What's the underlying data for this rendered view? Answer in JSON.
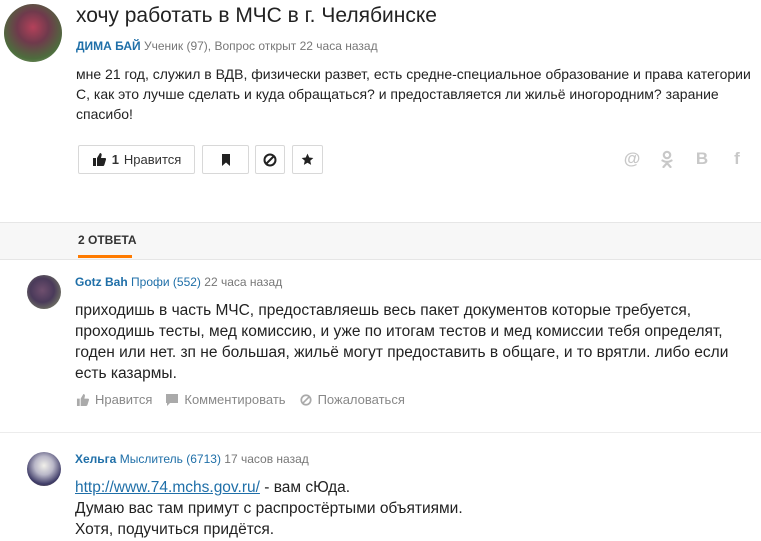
{
  "question": {
    "title": "хочу работать в МЧС в г. Челябинске",
    "author": "ДИМА БАЙ",
    "rank": "Ученик (97),",
    "status": "Вопрос открыт 22 часа назад",
    "text": "мне 21 год, служил в ВДВ, физически развет, есть средне-специальное образование и права категории С, как это лучше сделать и куда обращаться? и предоставляется ли жильё иногородним? зарание спасибо!",
    "like_count": "1",
    "like_label": "Нравится"
  },
  "share_icons": [
    "mail-icon",
    "odnoklassniki-icon",
    "vk-icon",
    "facebook-icon"
  ],
  "share": {
    "mail": "@",
    "ok": "ок",
    "vk": "В",
    "fb": "f"
  },
  "tabs": {
    "answers_label": "2 ОТВЕТА"
  },
  "answers": [
    {
      "author": "Gotz Bah",
      "rank": "Профи (552)",
      "time": "22 часа назад",
      "text": "приходишь в часть МЧС, предоставляешь весь пакет документов которые требуется, проходишь тесты, мед комиссию, и уже по итогам тестов и мед комиссии тебя определят, годен или нет. зп не большая, жильё могут предоставить в общаге, и то врятли. либо если есть казармы.",
      "actions": {
        "like": "Нравится",
        "comment": "Комментировать",
        "report": "Пожаловаться"
      }
    },
    {
      "author": "Хельга",
      "rank": "Мыслитель (6713)",
      "time": "17 часов назад",
      "link": "http://www.74.mchs.gov.ru/",
      "line1_rest": " - вам сЮда.",
      "line2": "Думаю вас там примут с распростёртыми объятиями.",
      "line3": "Хотя, подучиться придётся."
    }
  ],
  "colors": {
    "accent": "#ff7b00",
    "link": "#1f6fa8"
  }
}
